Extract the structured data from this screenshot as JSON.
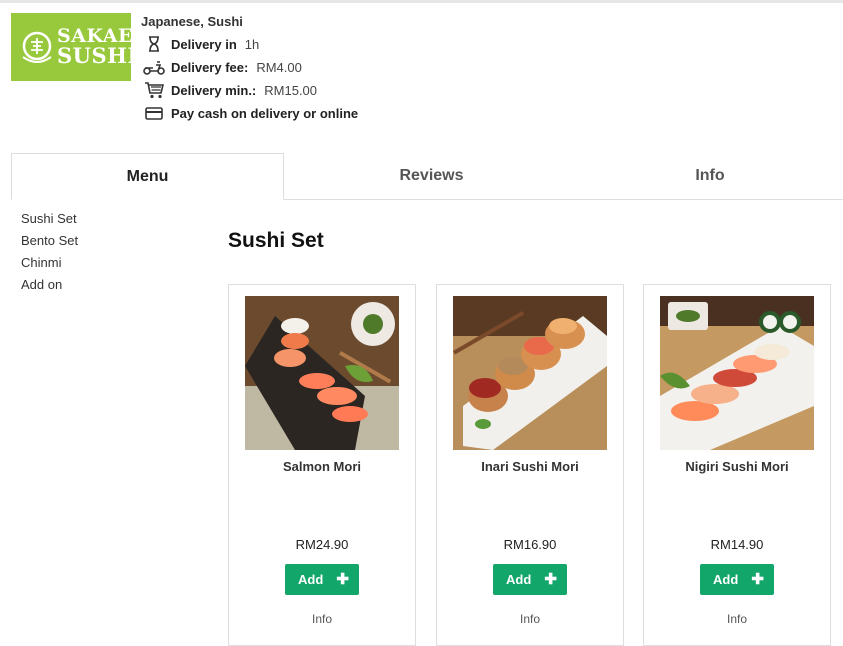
{
  "header": {
    "logo_line1": "SAKAE",
    "logo_line2": "SUSHI",
    "cuisine": "Japanese, Sushi",
    "delivery_time_label": "Delivery in",
    "delivery_time_value": "1h",
    "delivery_fee_label": "Delivery fee:",
    "delivery_fee_value": "RM4.00",
    "delivery_min_label": "Delivery min.:",
    "delivery_min_value": "RM15.00",
    "payment_label": "Pay cash on delivery or online"
  },
  "tabs": [
    {
      "label": "Menu",
      "active": true
    },
    {
      "label": "Reviews",
      "active": false
    },
    {
      "label": "Info",
      "active": false
    }
  ],
  "sidebar": {
    "items": [
      {
        "label": "Sushi Set"
      },
      {
        "label": "Bento Set"
      },
      {
        "label": "Chinmi"
      },
      {
        "label": "Add on"
      }
    ]
  },
  "main": {
    "section_title": "Sushi Set",
    "products": [
      {
        "name": "Salmon Mori",
        "price": "RM24.90",
        "add_label": "Add",
        "info_label": "Info"
      },
      {
        "name": "Inari Sushi Mori",
        "price": "RM16.90",
        "add_label": "Add",
        "info_label": "Info"
      },
      {
        "name": "Nigiri Sushi Mori",
        "price": "RM14.90",
        "add_label": "Add",
        "info_label": "Info"
      }
    ]
  },
  "colors": {
    "brand_green": "#98c93c",
    "add_button": "#12a66b"
  },
  "icons": {
    "delivery_time": "hourglass-icon",
    "delivery_fee": "scooter-icon",
    "delivery_min": "cart-icon",
    "payment": "card-icon",
    "add": "plus-icon"
  }
}
